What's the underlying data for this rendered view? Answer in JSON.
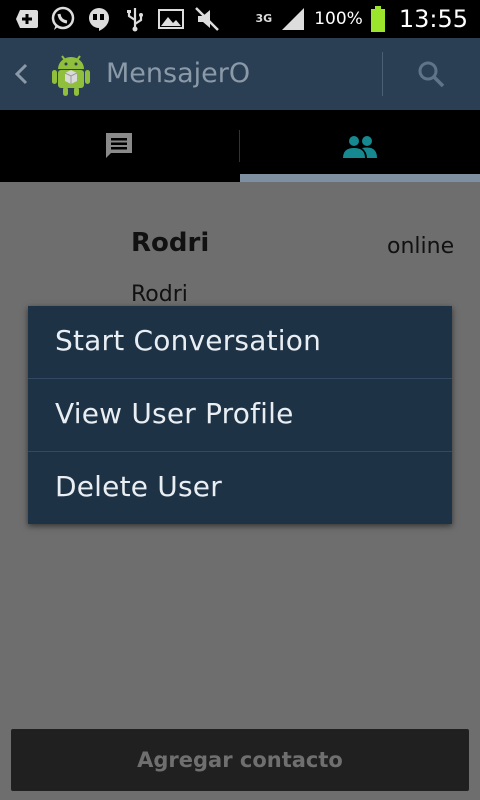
{
  "status_bar": {
    "icons": [
      "add-icon",
      "whatsapp-icon",
      "hangouts-icon",
      "usb-icon",
      "gallery-icon",
      "mute-icon"
    ],
    "network": "3G",
    "battery_percent": "100%",
    "time": "13:55",
    "battery_color": "#9be52d"
  },
  "action_bar": {
    "title": "MensajerO",
    "background": "#2b3f54"
  },
  "tabs": [
    {
      "icon": "chat-icon",
      "selected": false
    },
    {
      "icon": "contacts-icon",
      "selected": true
    }
  ],
  "contact": {
    "name": "Rodri",
    "status": "online",
    "subtitle": "Rodri"
  },
  "context_menu": {
    "items": [
      {
        "label": "Start Conversation"
      },
      {
        "label": "View User Profile"
      },
      {
        "label": "Delete User"
      }
    ]
  },
  "add_button": {
    "label": "Agregar contacto"
  }
}
